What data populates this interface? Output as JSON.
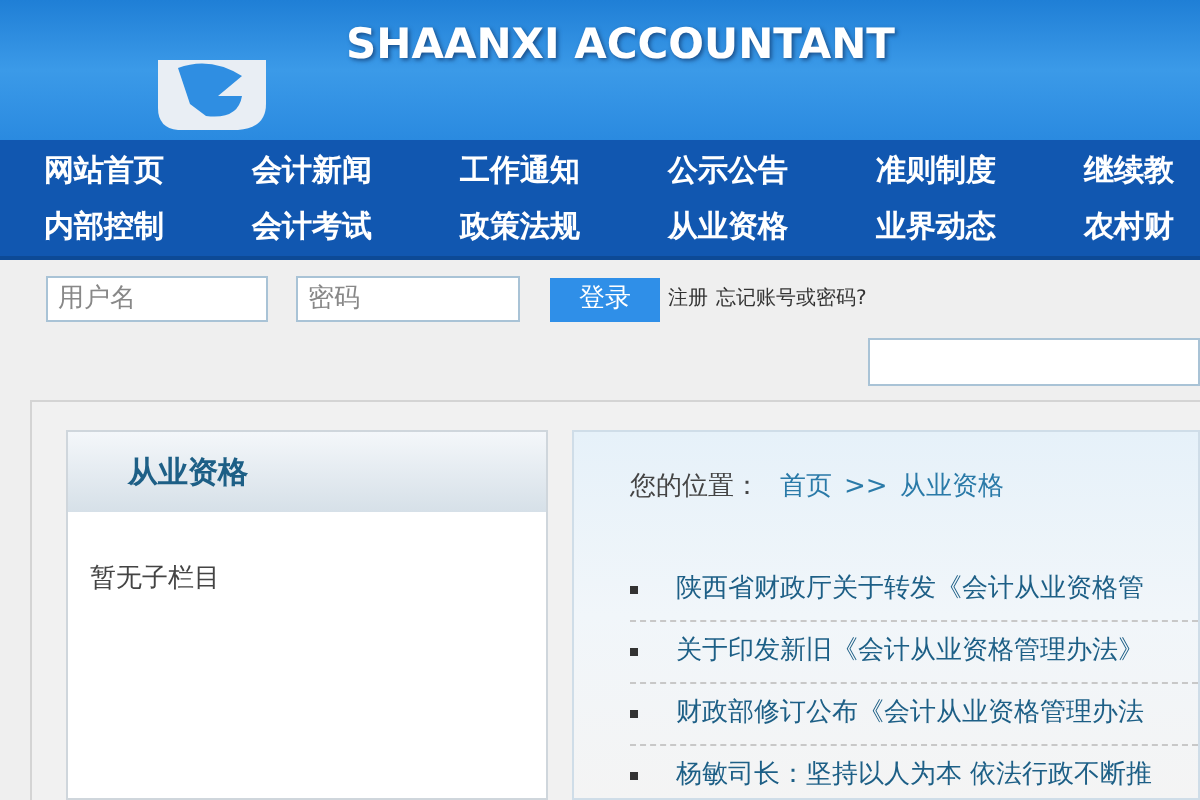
{
  "header": {
    "subtitle": "SHAANXI ACCOUNTANT"
  },
  "nav": {
    "rows": [
      [
        "网站首页",
        "会计新闻",
        "工作通知",
        "公示公告",
        "准则制度",
        "继续教"
      ],
      [
        "内部控制",
        "会计考试",
        "政策法规",
        "从业资格",
        "业界动态",
        "农村财"
      ]
    ]
  },
  "login": {
    "username_placeholder": "用户名",
    "password_placeholder": "密码",
    "button": "登录",
    "register": "注册",
    "forgot": "忘记账号或密码?"
  },
  "sidebar": {
    "title": "从业资格",
    "empty_text": "暂无子栏目"
  },
  "breadcrumb": {
    "label": "您的位置：",
    "home": "首页",
    "separator": ">>",
    "current": "从业资格"
  },
  "articles": [
    {
      "title": "陕西省财政厅关于转发《会计从业资格管"
    },
    {
      "title": "关于印发新旧《会计从业资格管理办法》"
    },
    {
      "title": "财政部修订公布《会计从业资格管理办法"
    },
    {
      "title": "杨敏司长：坚持以人为本 依法行政不断推"
    }
  ]
}
